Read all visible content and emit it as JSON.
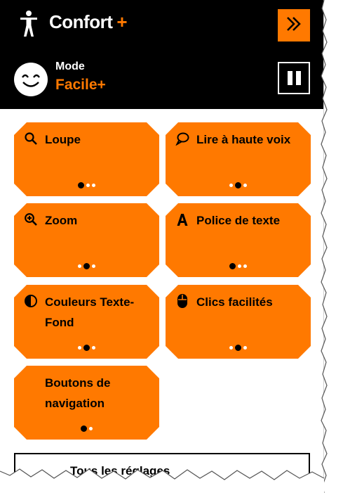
{
  "header": {
    "title": "Confort",
    "title_plus": "+",
    "expand_icon": "double-chevron-right-icon",
    "person_icon": "accessibility-person-icon",
    "mode_label": "Mode",
    "mode_value": "Facile+",
    "pause_icon": "pause-icon",
    "accent_color": "#ff7900"
  },
  "tiles": [
    {
      "label": "Loupe",
      "icon": "magnifier-icon",
      "dots": 3,
      "active_dot": 0
    },
    {
      "label": "Lire à haute voix",
      "icon": "speech-bubble-icon",
      "dots": 3,
      "active_dot": 1
    },
    {
      "label": "Zoom",
      "icon": "zoom-in-icon",
      "dots": 3,
      "active_dot": 1
    },
    {
      "label": "Police de texte",
      "icon": "font-a-icon",
      "dots": 3,
      "active_dot": 0
    },
    {
      "label": "Couleurs Texte-Fond",
      "icon": "contrast-icon",
      "dots": 3,
      "active_dot": 1
    },
    {
      "label": "Clics facilités",
      "icon": "mouse-icon",
      "dots": 3,
      "active_dot": 1
    },
    {
      "label": "Boutons de navigation",
      "icon": "",
      "dots": 2,
      "active_dot": 0
    }
  ],
  "footer": {
    "all_settings_label": "Tous les réglages"
  }
}
